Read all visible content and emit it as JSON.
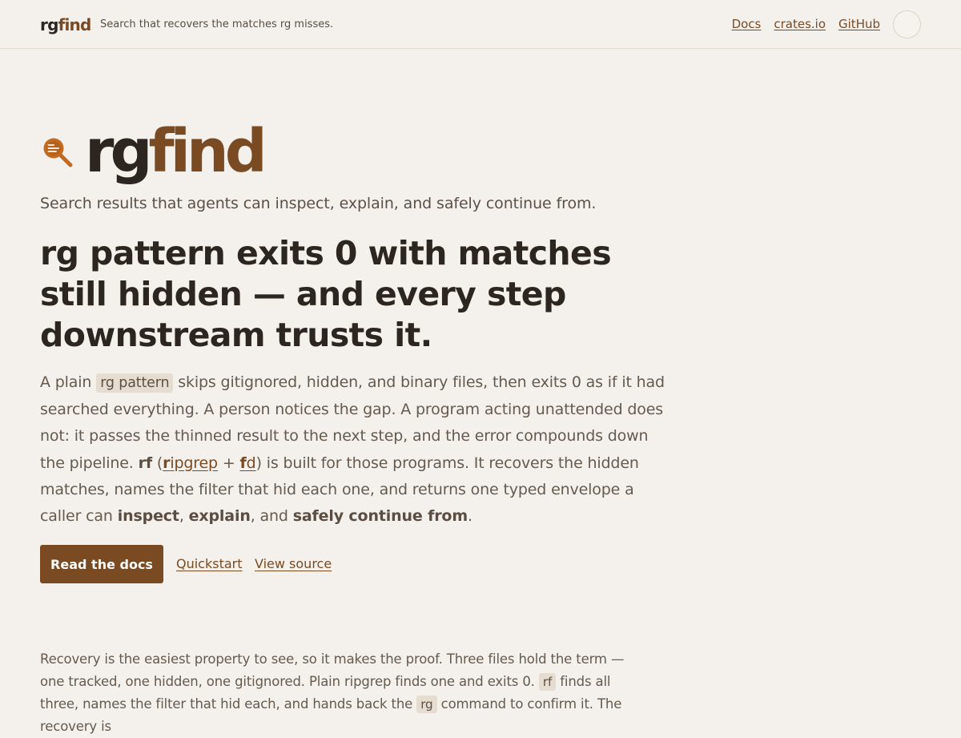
{
  "header": {
    "brand_a": "rg",
    "brand_b": "find",
    "tagline": "Search that recovers the matches rg misses.",
    "nav": [
      "Docs",
      "crates.io",
      "GitHub"
    ]
  },
  "hero": {
    "logo_a": "rg",
    "logo_b": "find",
    "subtitle": "Search results that agents can inspect, explain, and safely continue from.",
    "headline": "rg pattern exits 0 with matches still hidden — and every step downstream trusts it.",
    "body": {
      "t1": "A plain ",
      "code1": "rg pattern",
      "t2": " skips gitignored, hidden, and binary files, then exits 0 as if it had searched everything. A person notices the gap. A program acting unattended does not: it passes the thinned result to the next step, and the error compounds down the pipeline. ",
      "rf": "rf",
      "t3": " (",
      "ripgrep_hl": "r",
      "ripgrep_rest": "ipgrep",
      "plus": " + ",
      "fd_hl": "f",
      "fd_rest": "d",
      "t4": ") is built for those programs. It recovers the hidden matches, names the filter that hid each one, and returns one typed envelope a caller can ",
      "inspect": "inspect",
      "c1": ", ",
      "explain": "explain",
      "c2": ", and ",
      "safely": "safely continue from",
      "end": "."
    }
  },
  "cta": {
    "primary": "Read the docs",
    "quickstart": "Quickstart",
    "source": "View source"
  },
  "proof": {
    "t1": "Recovery is the easiest property to see, so it makes the proof. Three files hold the term — one tracked, one hidden, one gitignored. Plain ripgrep finds one and exits 0. ",
    "code1": "rf",
    "t2": " finds all three, names the filter that hid each, and hands back the ",
    "code2": "rg",
    "t3": " command to confirm it. The recovery is"
  },
  "colors": {
    "background": "#f4f1ec",
    "accent": "#7a4a22",
    "text": "#2d2620"
  },
  "icons": {
    "logo": "magnifier-icon",
    "theme_toggle": "theme-toggle-icon"
  }
}
